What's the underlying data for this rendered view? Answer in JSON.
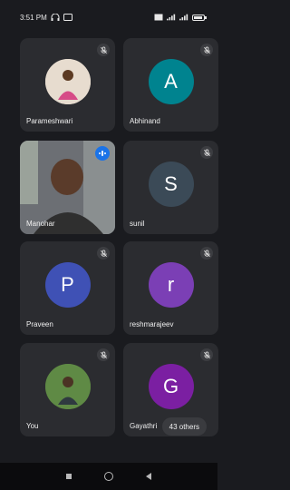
{
  "status_bar": {
    "time": "3:51 PM"
  },
  "participants": [
    {
      "name": "Parameshwari",
      "avatar_type": "photo",
      "avatar_bg": "#e7dccf",
      "muted": true
    },
    {
      "name": "Abhinand",
      "avatar_letter": "A",
      "avatar_bg": "#00838f",
      "muted": true
    },
    {
      "name": "Manohar",
      "avatar_type": "video",
      "speaking": true
    },
    {
      "name": "sunil",
      "avatar_letter": "S",
      "avatar_bg": "#3b4a57",
      "muted": true
    },
    {
      "name": "Praveen",
      "avatar_letter": "P",
      "avatar_bg": "#3f51b5",
      "muted": true
    },
    {
      "name": "reshmarajeev",
      "avatar_letter": "r",
      "avatar_bg": "#7b3fb5",
      "muted": true
    },
    {
      "name": "You",
      "avatar_type": "photo",
      "avatar_bg": "#4a6b3a",
      "muted": true
    },
    {
      "name": "Gayathri",
      "avatar_letter": "G",
      "avatar_bg": "#7b1fa2",
      "muted": true
    }
  ],
  "others_label": "43 others",
  "colors": {
    "tile_bg": "#2b2c30",
    "page_bg": "#1a1b1f",
    "speaking_blue": "#1a73e8"
  },
  "icons": {
    "mute": "mic-off-icon",
    "speaking": "audio-level-icon",
    "nav_recents": "square-icon",
    "nav_home": "circle-icon",
    "nav_back": "triangle-back-icon"
  }
}
